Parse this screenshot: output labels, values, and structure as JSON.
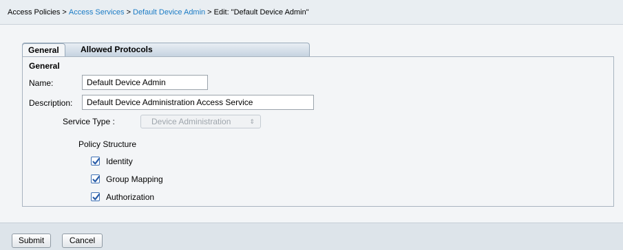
{
  "breadcrumb": {
    "root": "Access Policies",
    "sep": ">",
    "link1": "Access Services",
    "link2": "Default Device Admin",
    "current": "Edit: \"Default Device Admin\""
  },
  "tabs": [
    "General",
    "Allowed Protocols"
  ],
  "general": {
    "section_title": "General",
    "name_label": "Name:",
    "name_value": "Default Device Admin",
    "description_label": "Description:",
    "description_value": "Default Device Administration Access Service",
    "service_type_label": "Service Type :",
    "service_type_value": "Device Administration",
    "policy_structure_label": "Policy Structure",
    "policy_items": [
      {
        "label": "Identity",
        "checked": true
      },
      {
        "label": "Group Mapping",
        "checked": true
      },
      {
        "label": "Authorization",
        "checked": true
      }
    ]
  },
  "buttons": {
    "submit": "Submit",
    "cancel": "Cancel"
  },
  "colors": {
    "link": "#1a7bc5",
    "checkbox_check": "#2a5da8"
  }
}
